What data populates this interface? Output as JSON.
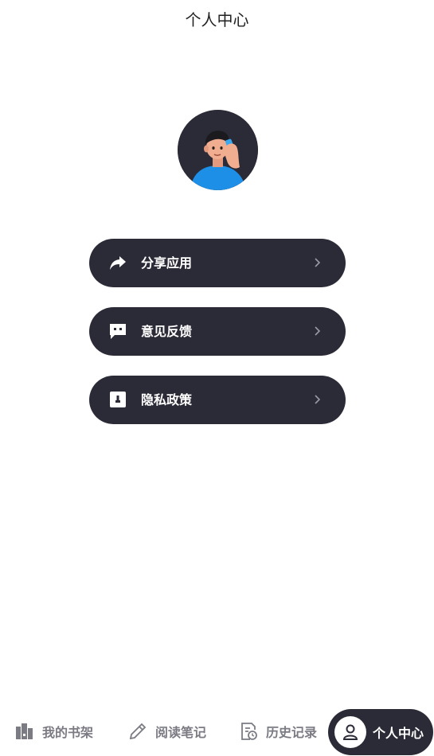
{
  "header": {
    "title": "个人中心"
  },
  "profile": {
    "avatar_icon": "user-avatar-illustration"
  },
  "menu": {
    "items": [
      {
        "label": "分享应用",
        "icon": "share-icon"
      },
      {
        "label": "意见反馈",
        "icon": "feedback-icon"
      },
      {
        "label": "隐私政策",
        "icon": "privacy-icon"
      }
    ]
  },
  "tabbar": {
    "tabs": [
      {
        "label": "我的书架",
        "icon": "bookshelf-icon"
      },
      {
        "label": "阅读笔记",
        "icon": "pencil-icon"
      },
      {
        "label": "历史记录",
        "icon": "history-icon"
      },
      {
        "label": "个人中心",
        "icon": "person-icon",
        "active": true
      }
    ]
  },
  "colors": {
    "accent": "#2b2b38",
    "inactive_tab": "#7b7b84",
    "background": "#ffffff"
  }
}
